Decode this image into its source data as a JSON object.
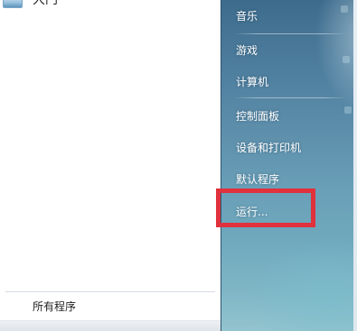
{
  "left_pane": {
    "partial_item_label": "大门",
    "all_programs_label": "所有程序"
  },
  "right_pane": {
    "items": [
      {
        "label": "音乐"
      },
      {
        "label": "游戏"
      },
      {
        "label": "计算机"
      },
      {
        "label": "控制面板"
      },
      {
        "label": "设备和打印机"
      },
      {
        "label": "默认程序"
      },
      {
        "label": "运行..."
      }
    ]
  },
  "annotation": {
    "highlight_color": "#e0313c",
    "highlighted_item": "运行..."
  },
  "colors": {
    "right_pane_top": "#3d6b8c",
    "right_pane_bottom": "#93c4cf",
    "link_text": "#ffffff"
  }
}
